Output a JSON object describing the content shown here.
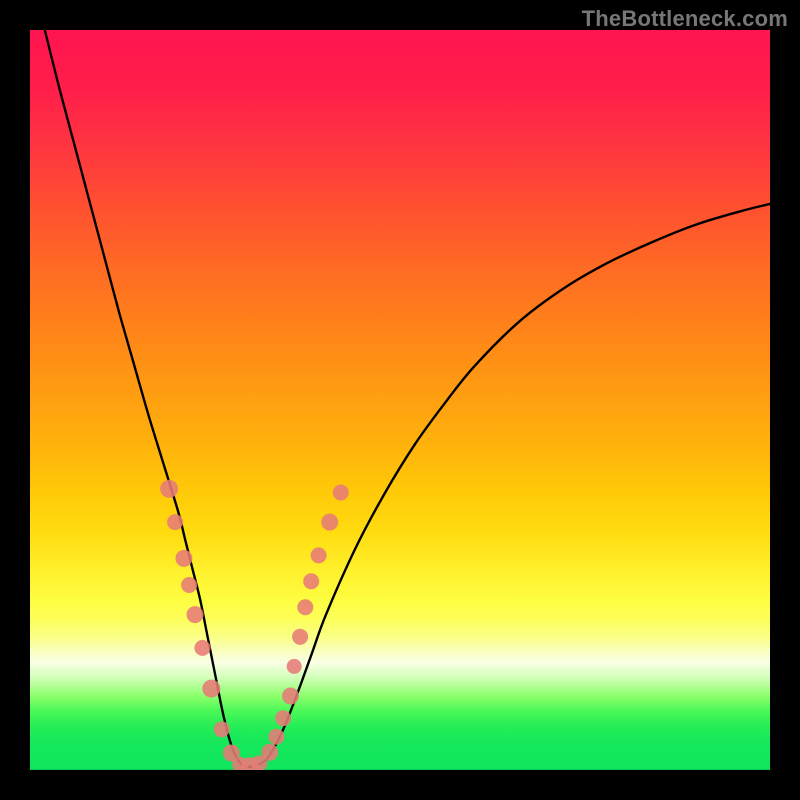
{
  "watermark": "TheBottleneck.com",
  "colors": {
    "frame": "#000000",
    "curve_stroke": "#000000",
    "marker_fill": "#e77b77",
    "marker_stroke": "#e77b77"
  },
  "chart_data": {
    "type": "line",
    "title": "",
    "xlabel": "",
    "ylabel": "",
    "xlim": [
      0,
      100
    ],
    "ylim": [
      0,
      100
    ],
    "grid": false,
    "legend": false,
    "series": [
      {
        "name": "bottleneck-curve",
        "x": [
          2,
          4,
          6,
          8,
          10,
          12,
          14,
          16,
          18,
          20,
          21,
          22,
          23,
          24,
          25,
          26,
          27,
          28,
          29,
          30,
          32,
          34,
          36,
          38,
          40,
          44,
          48,
          52,
          56,
          60,
          66,
          72,
          78,
          84,
          90,
          96,
          100
        ],
        "y": [
          100,
          92,
          84.5,
          77,
          69.5,
          62,
          55,
          48,
          41.5,
          35,
          31,
          27,
          23,
          18,
          13,
          8,
          4,
          1.5,
          0.5,
          0.5,
          1.5,
          5,
          10,
          15.5,
          21,
          30,
          37.5,
          44,
          49.5,
          54.5,
          60.5,
          65,
          68.5,
          71.3,
          73.7,
          75.5,
          76.5
        ]
      }
    ],
    "markers": [
      {
        "x": 18.8,
        "y": 38,
        "r": 9
      },
      {
        "x": 19.6,
        "y": 33.5,
        "r": 8
      },
      {
        "x": 20.8,
        "y": 28.6,
        "r": 8.5
      },
      {
        "x": 21.5,
        "y": 25,
        "r": 8
      },
      {
        "x": 22.3,
        "y": 21,
        "r": 8.5
      },
      {
        "x": 23.3,
        "y": 16.5,
        "r": 8
      },
      {
        "x": 24.5,
        "y": 11,
        "r": 9
      },
      {
        "x": 25.9,
        "y": 5.5,
        "r": 8
      },
      {
        "x": 27.2,
        "y": 2.3,
        "r": 8.5
      },
      {
        "x": 28.4,
        "y": 0.7,
        "r": 8
      },
      {
        "x": 29.7,
        "y": 0.5,
        "r": 9
      },
      {
        "x": 31.0,
        "y": 0.9,
        "r": 8
      },
      {
        "x": 32.4,
        "y": 2.4,
        "r": 8.5
      },
      {
        "x": 33.3,
        "y": 4.5,
        "r": 8
      },
      {
        "x": 34.2,
        "y": 7,
        "r": 8
      },
      {
        "x": 35.2,
        "y": 10,
        "r": 8.5
      },
      {
        "x": 35.7,
        "y": 14,
        "r": 7.5
      },
      {
        "x": 36.5,
        "y": 18,
        "r": 8
      },
      {
        "x": 37.2,
        "y": 22,
        "r": 8
      },
      {
        "x": 38.0,
        "y": 25.5,
        "r": 8
      },
      {
        "x": 39.0,
        "y": 29,
        "r": 8
      },
      {
        "x": 40.5,
        "y": 33.5,
        "r": 8.5
      },
      {
        "x": 42.0,
        "y": 37.5,
        "r": 8
      }
    ]
  }
}
